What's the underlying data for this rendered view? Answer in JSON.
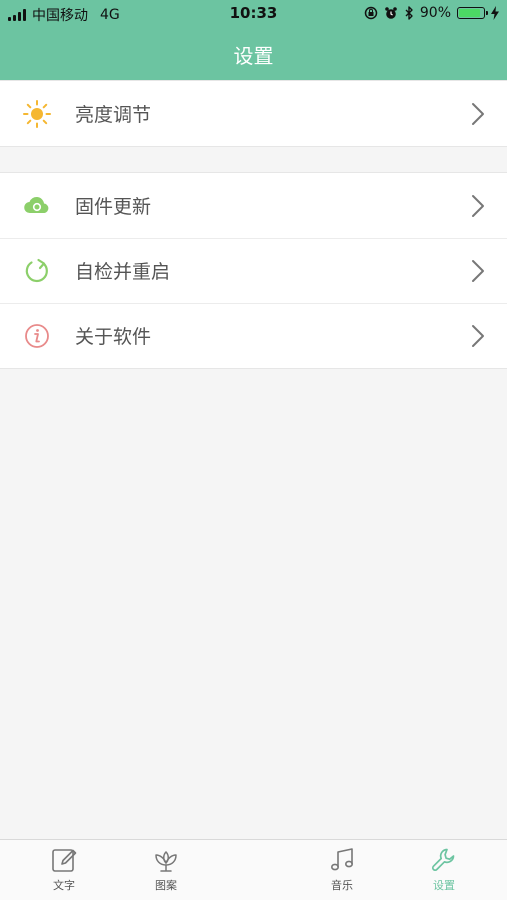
{
  "status_bar": {
    "carrier": "中国移动",
    "network": "4G",
    "time": "10:33",
    "battery_percent": "90%",
    "battery_level": 0.9
  },
  "header": {
    "title": "设置"
  },
  "settings": {
    "groups": [
      {
        "items": [
          {
            "label": "亮度调节",
            "icon": "sun-icon"
          }
        ]
      },
      {
        "items": [
          {
            "label": "固件更新",
            "icon": "cloud-icon"
          },
          {
            "label": "自检并重启",
            "icon": "restart-icon"
          },
          {
            "label": "关于软件",
            "icon": "info-icon"
          }
        ]
      }
    ]
  },
  "tabbar": {
    "tabs": [
      {
        "label": "文字",
        "icon": "edit-icon",
        "active": false
      },
      {
        "label": "图案",
        "icon": "flower-icon",
        "active": false
      },
      {
        "label": "音乐",
        "icon": "music-icon",
        "active": false
      },
      {
        "label": "设置",
        "icon": "wrench-icon",
        "active": true
      }
    ]
  },
  "colors": {
    "accent": "#6cc4a1",
    "sun": "#f5b731",
    "cloud": "#8ccf6a",
    "restart": "#8ccf6a",
    "info": "#e88a8a"
  }
}
